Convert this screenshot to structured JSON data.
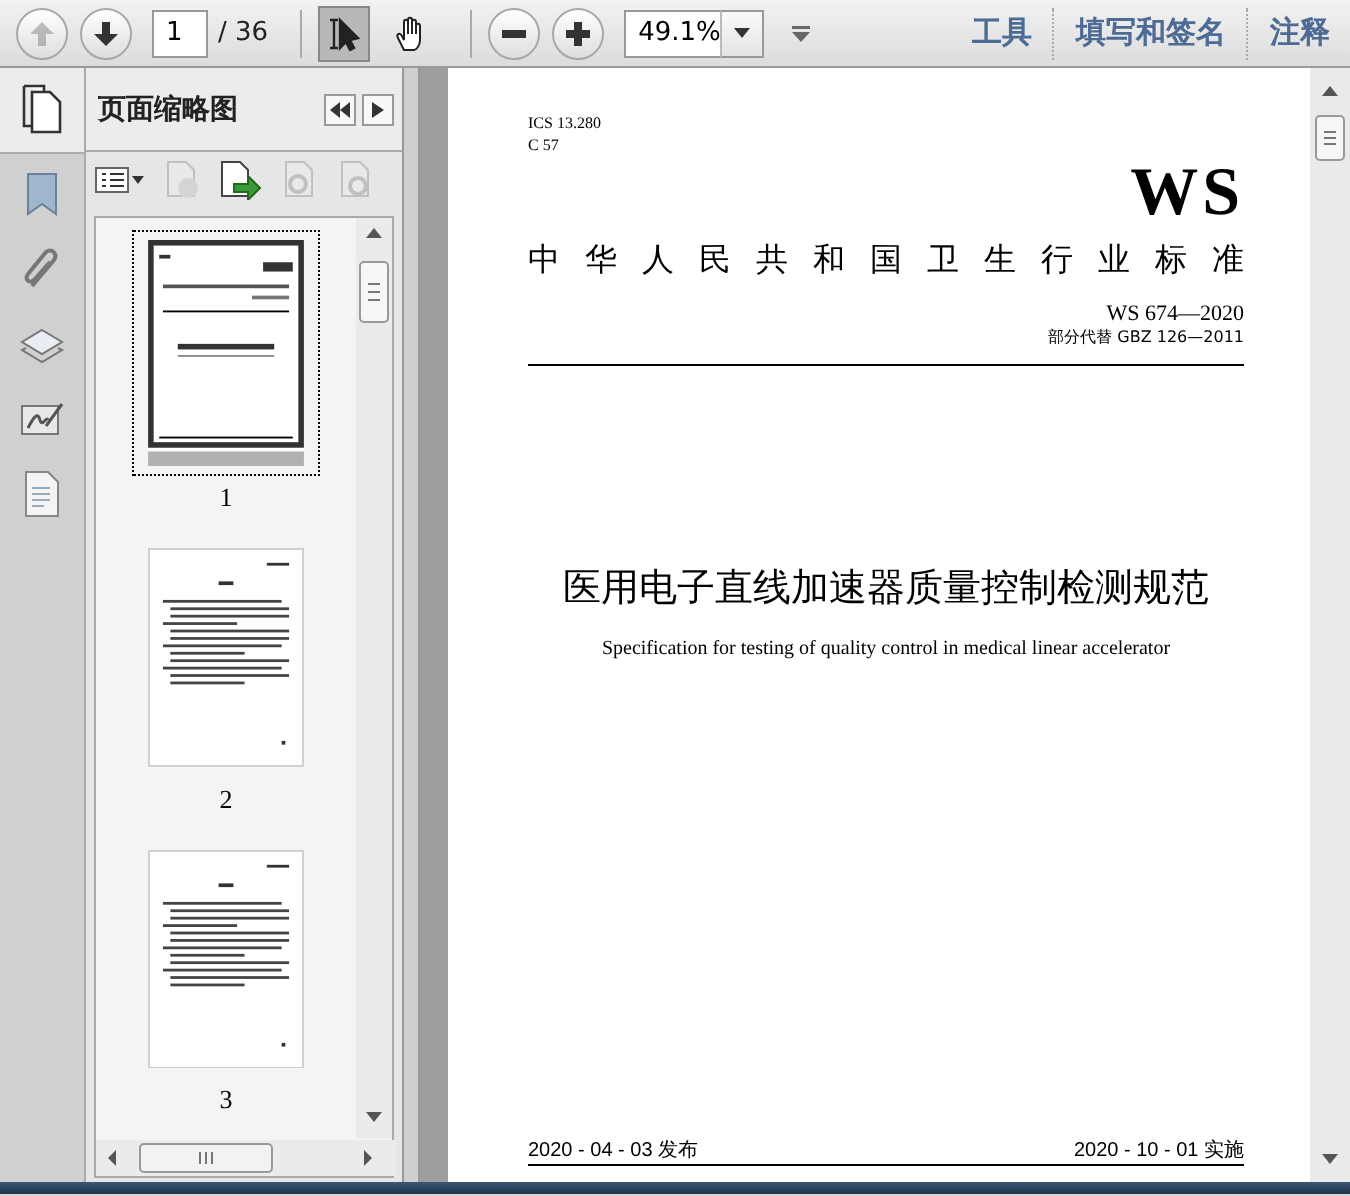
{
  "toolbar": {
    "page_field": {
      "value": "1"
    },
    "page_count": "/ 36",
    "tools": [
      {
        "kind": "select",
        "selected": true
      },
      {
        "kind": "hand",
        "selected": false
      }
    ],
    "zoom_field": {
      "value": "49.1%"
    },
    "menus": [
      "工具",
      "填写和签名",
      "注释"
    ]
  },
  "thumbnails_panel": {
    "title": "页面缩略图",
    "pages": [
      {
        "label": "1",
        "selected": true
      },
      {
        "label": "2",
        "selected": false
      },
      {
        "label": "3",
        "selected": false
      }
    ]
  },
  "document": {
    "ics": "ICS 13.280",
    "ccs": "C 57",
    "logo": "WS",
    "issuer": "中华人民共和国卫生行业标准",
    "number": "WS 674—2020",
    "replaces": "部分代替 GBZ 126—2011",
    "title": "医用电子直线加速器质量控制检测规范",
    "subtitle": "Specification for testing of quality control in medical linear accelerator",
    "published": "2020 - 04 - 03 发布",
    "effective": "2020 - 10 - 01 实施"
  }
}
